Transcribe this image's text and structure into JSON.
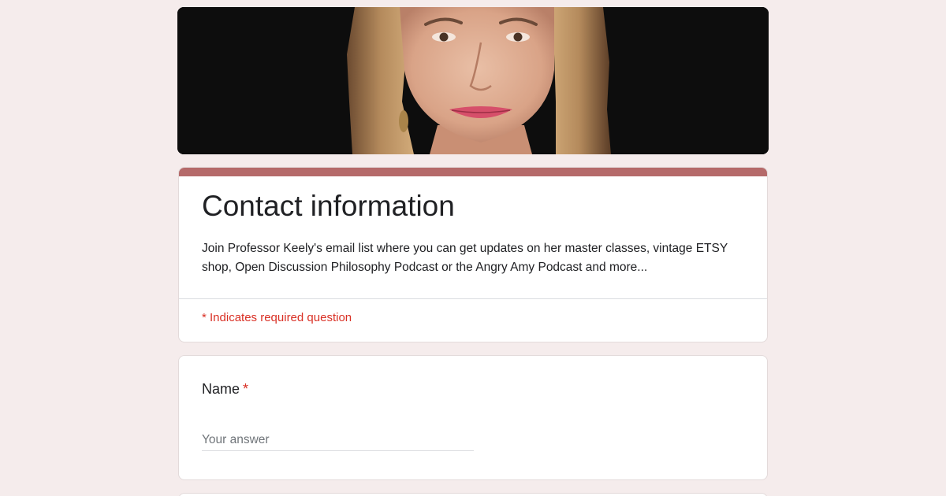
{
  "form": {
    "title": "Contact information",
    "description": "Join Professor Keely's email list where you can get updates on her master classes, vintage ETSY shop, Open Discussion Philosophy Podcast or the Angry Amy Podcast and more...",
    "required_note": "* Indicates required question",
    "accent_color": "#b56a6a",
    "background_color": "#f5ecec"
  },
  "questions": [
    {
      "label": "Name",
      "required_mark": "*",
      "placeholder": "Your answer"
    }
  ],
  "header_image": {
    "subject": "portrait-photo"
  }
}
